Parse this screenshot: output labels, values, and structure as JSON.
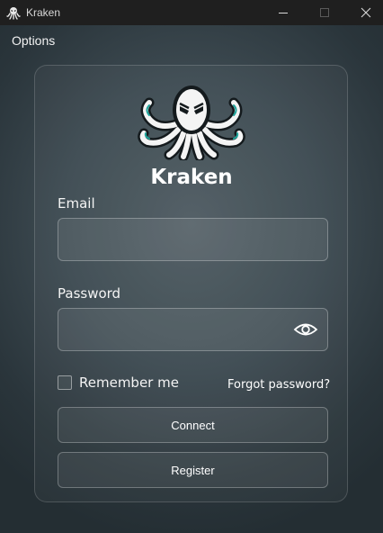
{
  "window": {
    "title": "Kraken"
  },
  "menu": {
    "options_label": "Options"
  },
  "brand": {
    "name": "Kraken"
  },
  "form": {
    "email_label": "Email",
    "email_value": "",
    "password_label": "Password",
    "password_value": "",
    "remember_label": "Remember me",
    "remember_checked": false,
    "forgot_label": "Forgot password?",
    "connect_label": "Connect",
    "register_label": "Register"
  },
  "icons": {
    "app": "octopus-icon",
    "minimize": "minimize-icon",
    "maximize": "maximize-icon",
    "close": "close-icon",
    "logo": "octopus-logo",
    "show_password": "eye-icon"
  }
}
